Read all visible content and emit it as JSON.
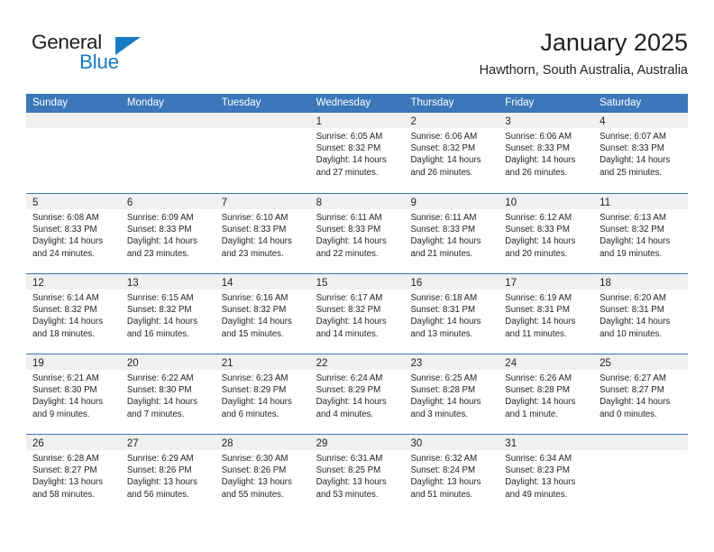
{
  "brand": {
    "name_part1": "General",
    "name_part2": "Blue",
    "triangle_color": "#1a7bc4"
  },
  "header": {
    "title": "January 2025",
    "subtitle": "Hawthorn, South Australia, Australia"
  },
  "theme": {
    "header_blue": "#3B77BA",
    "day_band_gray": "#f0f0f0",
    "text": "#231f20"
  },
  "weekdays": [
    "Sunday",
    "Monday",
    "Tuesday",
    "Wednesday",
    "Thursday",
    "Friday",
    "Saturday"
  ],
  "weeks": [
    [
      {
        "day": "",
        "lines": []
      },
      {
        "day": "",
        "lines": []
      },
      {
        "day": "",
        "lines": []
      },
      {
        "day": "1",
        "lines": [
          "Sunrise: 6:05 AM",
          "Sunset: 8:32 PM",
          "Daylight: 14 hours",
          "and 27 minutes."
        ]
      },
      {
        "day": "2",
        "lines": [
          "Sunrise: 6:06 AM",
          "Sunset: 8:32 PM",
          "Daylight: 14 hours",
          "and 26 minutes."
        ]
      },
      {
        "day": "3",
        "lines": [
          "Sunrise: 6:06 AM",
          "Sunset: 8:33 PM",
          "Daylight: 14 hours",
          "and 26 minutes."
        ]
      },
      {
        "day": "4",
        "lines": [
          "Sunrise: 6:07 AM",
          "Sunset: 8:33 PM",
          "Daylight: 14 hours",
          "and 25 minutes."
        ]
      }
    ],
    [
      {
        "day": "5",
        "lines": [
          "Sunrise: 6:08 AM",
          "Sunset: 8:33 PM",
          "Daylight: 14 hours",
          "and 24 minutes."
        ]
      },
      {
        "day": "6",
        "lines": [
          "Sunrise: 6:09 AM",
          "Sunset: 8:33 PM",
          "Daylight: 14 hours",
          "and 23 minutes."
        ]
      },
      {
        "day": "7",
        "lines": [
          "Sunrise: 6:10 AM",
          "Sunset: 8:33 PM",
          "Daylight: 14 hours",
          "and 23 minutes."
        ]
      },
      {
        "day": "8",
        "lines": [
          "Sunrise: 6:11 AM",
          "Sunset: 8:33 PM",
          "Daylight: 14 hours",
          "and 22 minutes."
        ]
      },
      {
        "day": "9",
        "lines": [
          "Sunrise: 6:11 AM",
          "Sunset: 8:33 PM",
          "Daylight: 14 hours",
          "and 21 minutes."
        ]
      },
      {
        "day": "10",
        "lines": [
          "Sunrise: 6:12 AM",
          "Sunset: 8:33 PM",
          "Daylight: 14 hours",
          "and 20 minutes."
        ]
      },
      {
        "day": "11",
        "lines": [
          "Sunrise: 6:13 AM",
          "Sunset: 8:32 PM",
          "Daylight: 14 hours",
          "and 19 minutes."
        ]
      }
    ],
    [
      {
        "day": "12",
        "lines": [
          "Sunrise: 6:14 AM",
          "Sunset: 8:32 PM",
          "Daylight: 14 hours",
          "and 18 minutes."
        ]
      },
      {
        "day": "13",
        "lines": [
          "Sunrise: 6:15 AM",
          "Sunset: 8:32 PM",
          "Daylight: 14 hours",
          "and 16 minutes."
        ]
      },
      {
        "day": "14",
        "lines": [
          "Sunrise: 6:16 AM",
          "Sunset: 8:32 PM",
          "Daylight: 14 hours",
          "and 15 minutes."
        ]
      },
      {
        "day": "15",
        "lines": [
          "Sunrise: 6:17 AM",
          "Sunset: 8:32 PM",
          "Daylight: 14 hours",
          "and 14 minutes."
        ]
      },
      {
        "day": "16",
        "lines": [
          "Sunrise: 6:18 AM",
          "Sunset: 8:31 PM",
          "Daylight: 14 hours",
          "and 13 minutes."
        ]
      },
      {
        "day": "17",
        "lines": [
          "Sunrise: 6:19 AM",
          "Sunset: 8:31 PM",
          "Daylight: 14 hours",
          "and 11 minutes."
        ]
      },
      {
        "day": "18",
        "lines": [
          "Sunrise: 6:20 AM",
          "Sunset: 8:31 PM",
          "Daylight: 14 hours",
          "and 10 minutes."
        ]
      }
    ],
    [
      {
        "day": "19",
        "lines": [
          "Sunrise: 6:21 AM",
          "Sunset: 8:30 PM",
          "Daylight: 14 hours",
          "and 9 minutes."
        ]
      },
      {
        "day": "20",
        "lines": [
          "Sunrise: 6:22 AM",
          "Sunset: 8:30 PM",
          "Daylight: 14 hours",
          "and 7 minutes."
        ]
      },
      {
        "day": "21",
        "lines": [
          "Sunrise: 6:23 AM",
          "Sunset: 8:29 PM",
          "Daylight: 14 hours",
          "and 6 minutes."
        ]
      },
      {
        "day": "22",
        "lines": [
          "Sunrise: 6:24 AM",
          "Sunset: 8:29 PM",
          "Daylight: 14 hours",
          "and 4 minutes."
        ]
      },
      {
        "day": "23",
        "lines": [
          "Sunrise: 6:25 AM",
          "Sunset: 8:28 PM",
          "Daylight: 14 hours",
          "and 3 minutes."
        ]
      },
      {
        "day": "24",
        "lines": [
          "Sunrise: 6:26 AM",
          "Sunset: 8:28 PM",
          "Daylight: 14 hours",
          "and 1 minute."
        ]
      },
      {
        "day": "25",
        "lines": [
          "Sunrise: 6:27 AM",
          "Sunset: 8:27 PM",
          "Daylight: 14 hours",
          "and 0 minutes."
        ]
      }
    ],
    [
      {
        "day": "26",
        "lines": [
          "Sunrise: 6:28 AM",
          "Sunset: 8:27 PM",
          "Daylight: 13 hours",
          "and 58 minutes."
        ]
      },
      {
        "day": "27",
        "lines": [
          "Sunrise: 6:29 AM",
          "Sunset: 8:26 PM",
          "Daylight: 13 hours",
          "and 56 minutes."
        ]
      },
      {
        "day": "28",
        "lines": [
          "Sunrise: 6:30 AM",
          "Sunset: 8:26 PM",
          "Daylight: 13 hours",
          "and 55 minutes."
        ]
      },
      {
        "day": "29",
        "lines": [
          "Sunrise: 6:31 AM",
          "Sunset: 8:25 PM",
          "Daylight: 13 hours",
          "and 53 minutes."
        ]
      },
      {
        "day": "30",
        "lines": [
          "Sunrise: 6:32 AM",
          "Sunset: 8:24 PM",
          "Daylight: 13 hours",
          "and 51 minutes."
        ]
      },
      {
        "day": "31",
        "lines": [
          "Sunrise: 6:34 AM",
          "Sunset: 8:23 PM",
          "Daylight: 13 hours",
          "and 49 minutes."
        ]
      },
      {
        "day": "",
        "lines": []
      }
    ]
  ]
}
